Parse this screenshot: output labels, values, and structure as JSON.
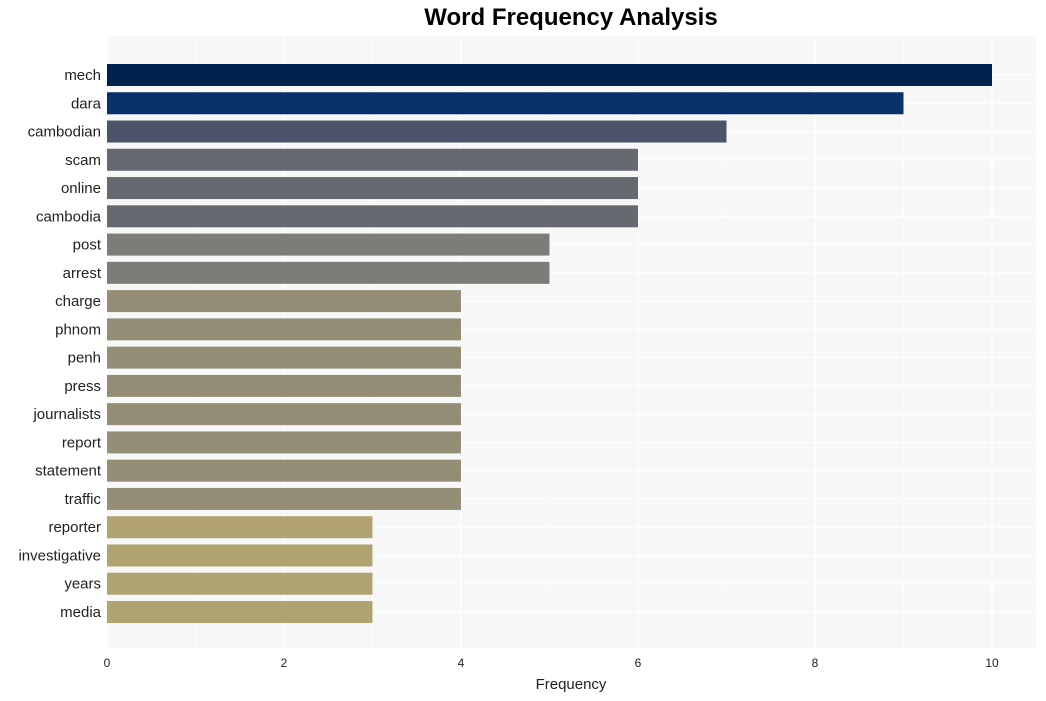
{
  "chart_data": {
    "type": "bar",
    "orientation": "horizontal",
    "title": "Word Frequency Analysis",
    "xlabel": "Frequency",
    "ylabel": "",
    "xlim": [
      0,
      10.5
    ],
    "xticks": [
      0,
      2,
      4,
      6,
      8,
      10
    ],
    "grid": true,
    "categories": [
      "mech",
      "dara",
      "cambodian",
      "scam",
      "online",
      "cambodia",
      "post",
      "arrest",
      "charge",
      "phnom",
      "penh",
      "press",
      "journalists",
      "report",
      "statement",
      "traffic",
      "reporter",
      "investigative",
      "years",
      "media"
    ],
    "values": [
      10,
      9,
      7,
      6,
      6,
      6,
      5,
      5,
      4,
      4,
      4,
      4,
      4,
      4,
      4,
      4,
      3,
      3,
      3,
      3
    ],
    "colors": [
      "#00204e",
      "#08306b",
      "#4b546b",
      "#666970",
      "#666970",
      "#666970",
      "#7d7c78",
      "#7d7c78",
      "#958e76",
      "#958e76",
      "#958e76",
      "#958e76",
      "#958e76",
      "#958e76",
      "#958e76",
      "#958e76",
      "#b0a370",
      "#b0a370",
      "#b0a370",
      "#b0a370"
    ],
    "plot_background": "#f7f7f7"
  }
}
